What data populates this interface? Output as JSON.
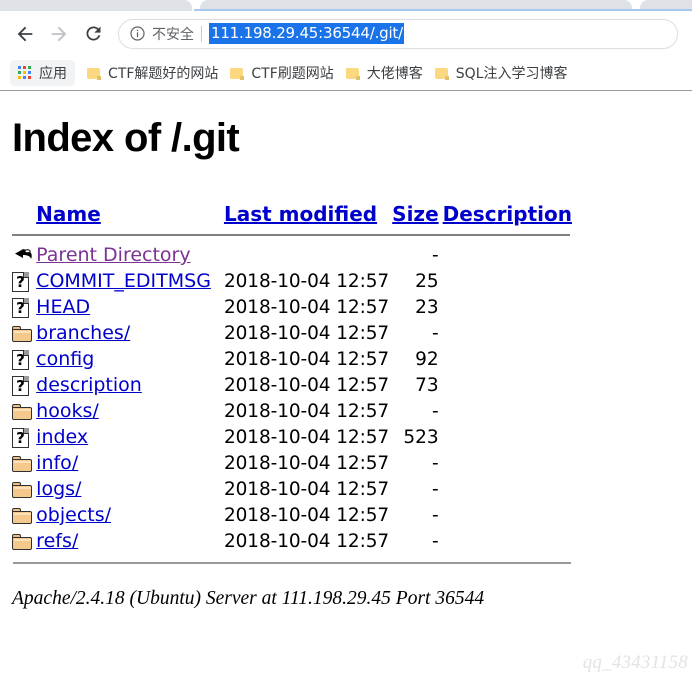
{
  "browser": {
    "nav": {
      "back_icon": "arrow-left-icon",
      "forward_icon": "arrow-right-icon",
      "reload_icon": "reload-icon"
    },
    "omnibox": {
      "info_icon": "info-circle-icon",
      "security_label": "不安全",
      "url": "111.198.29.45:36544/.git/",
      "selected": true,
      "selection_color": "#1a73e8"
    },
    "bookmarks": {
      "apps": {
        "icon": "apps-grid-icon",
        "label": "应用"
      },
      "items": [
        {
          "icon": "folder-icon",
          "label": "CTF解题好的网站"
        },
        {
          "icon": "folder-icon",
          "label": "CTF刷题网站"
        },
        {
          "icon": "folder-icon",
          "label": "大佬博客"
        },
        {
          "icon": "folder-icon",
          "label": "SQL注入学习博客"
        }
      ]
    }
  },
  "page": {
    "title": "Index of /.git",
    "columns": [
      {
        "label": "Name"
      },
      {
        "label": "Last modified"
      },
      {
        "label": "Size"
      },
      {
        "label": "Description"
      }
    ],
    "rows": [
      {
        "icon": "back-arrow-icon",
        "name": "Parent Directory",
        "visited": true,
        "date": "",
        "size": "-",
        "desc": ""
      },
      {
        "icon": "unknown-file-icon",
        "name": "COMMIT_EDITMSG",
        "visited": false,
        "date": "2018-10-04 12:57",
        "size": "25",
        "desc": ""
      },
      {
        "icon": "unknown-file-icon",
        "name": "HEAD",
        "visited": false,
        "date": "2018-10-04 12:57",
        "size": "23",
        "desc": ""
      },
      {
        "icon": "directory-icon",
        "name": "branches/",
        "visited": false,
        "date": "2018-10-04 12:57",
        "size": "-",
        "desc": ""
      },
      {
        "icon": "unknown-file-icon",
        "name": "config",
        "visited": false,
        "date": "2018-10-04 12:57",
        "size": "92",
        "desc": ""
      },
      {
        "icon": "unknown-file-icon",
        "name": "description",
        "visited": false,
        "date": "2018-10-04 12:57",
        "size": "73",
        "desc": ""
      },
      {
        "icon": "directory-icon",
        "name": "hooks/",
        "visited": false,
        "date": "2018-10-04 12:57",
        "size": "-",
        "desc": ""
      },
      {
        "icon": "unknown-file-icon",
        "name": "index",
        "visited": false,
        "date": "2018-10-04 12:57",
        "size": "523",
        "desc": ""
      },
      {
        "icon": "directory-icon",
        "name": "info/",
        "visited": false,
        "date": "2018-10-04 12:57",
        "size": "-",
        "desc": ""
      },
      {
        "icon": "directory-icon",
        "name": "logs/",
        "visited": false,
        "date": "2018-10-04 12:57",
        "size": "-",
        "desc": ""
      },
      {
        "icon": "directory-icon",
        "name": "objects/",
        "visited": false,
        "date": "2018-10-04 12:57",
        "size": "-",
        "desc": ""
      },
      {
        "icon": "directory-icon",
        "name": "refs/",
        "visited": false,
        "date": "2018-10-04 12:57",
        "size": "-",
        "desc": ""
      }
    ],
    "footer": "Apache/2.4.18 (Ubuntu) Server at 111.198.29.45 Port 36544",
    "watermark": "qq_43431158",
    "link_color": "#0000cc",
    "visited_link_color": "#7b3294"
  }
}
